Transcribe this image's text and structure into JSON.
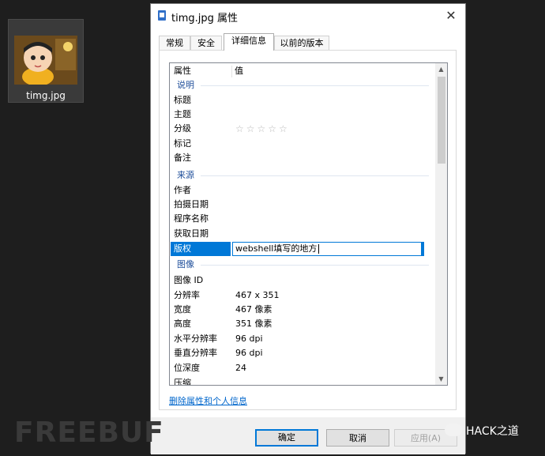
{
  "desktop": {
    "file_label": "timg.jpg"
  },
  "dialog": {
    "title": "timg.jpg 属性",
    "close_glyph": "✕",
    "tabs": [
      "常规",
      "安全",
      "详细信息",
      "以前的版本"
    ],
    "active_tab": "详细信息",
    "columns": {
      "name": "属性",
      "value": "值"
    },
    "groups": {
      "description": "说明",
      "origin": "来源",
      "image": "图像"
    },
    "desc_rows": [
      {
        "name": "标题",
        "value": ""
      },
      {
        "name": "主题",
        "value": ""
      },
      {
        "name": "分级",
        "value": "☆☆☆☆☆"
      },
      {
        "name": "标记",
        "value": ""
      },
      {
        "name": "备注",
        "value": ""
      }
    ],
    "origin_rows": [
      {
        "name": "作者",
        "value": ""
      },
      {
        "name": "拍摄日期",
        "value": ""
      },
      {
        "name": "程序名称",
        "value": ""
      },
      {
        "name": "获取日期",
        "value": ""
      },
      {
        "name": "版权",
        "value": "webshell填写的地方"
      }
    ],
    "image_rows": [
      {
        "name": "图像 ID",
        "value": ""
      },
      {
        "name": "分辨率",
        "value": "467 x 351"
      },
      {
        "name": "宽度",
        "value": "467 像素"
      },
      {
        "name": "高度",
        "value": "351 像素"
      },
      {
        "name": "水平分辨率",
        "value": "96 dpi"
      },
      {
        "name": "垂直分辨率",
        "value": "96 dpi"
      },
      {
        "name": "位深度",
        "value": "24"
      },
      {
        "name": "压缩",
        "value": ""
      }
    ],
    "remove_link": "删除属性和个人信息",
    "buttons": {
      "ok": "确定",
      "cancel": "取消",
      "apply": "应用(A)"
    }
  },
  "watermark": {
    "left": "FREEBUF",
    "right": "HACK之道"
  },
  "colors": {
    "selection": "#0078d7",
    "group_text": "#1e4e9a",
    "link": "#0066cc"
  }
}
